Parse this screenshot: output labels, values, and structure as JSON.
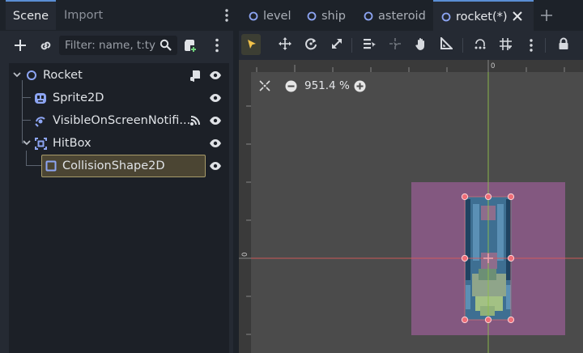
{
  "dock": {
    "tabs": [
      "Scene",
      "Import"
    ],
    "filter_placeholder": "Filter: name, t:ty"
  },
  "tree": {
    "nodes": [
      {
        "label": "Rocket"
      },
      {
        "label": "Sprite2D"
      },
      {
        "label": "VisibleOnScreenNotifi..."
      },
      {
        "label": "HitBox"
      },
      {
        "label": "CollisionShape2D"
      }
    ]
  },
  "scene_tabs": [
    "level",
    "ship",
    "asteroid",
    "rocket(*)"
  ],
  "viewport": {
    "zoom": "951.4 %",
    "ruler_zero": "0"
  },
  "colors": {
    "accent": "#5a8ed4",
    "selection_border": "#a79b6a",
    "node_2d": "#8da5f3",
    "shape_fill": "#8a5a86"
  }
}
